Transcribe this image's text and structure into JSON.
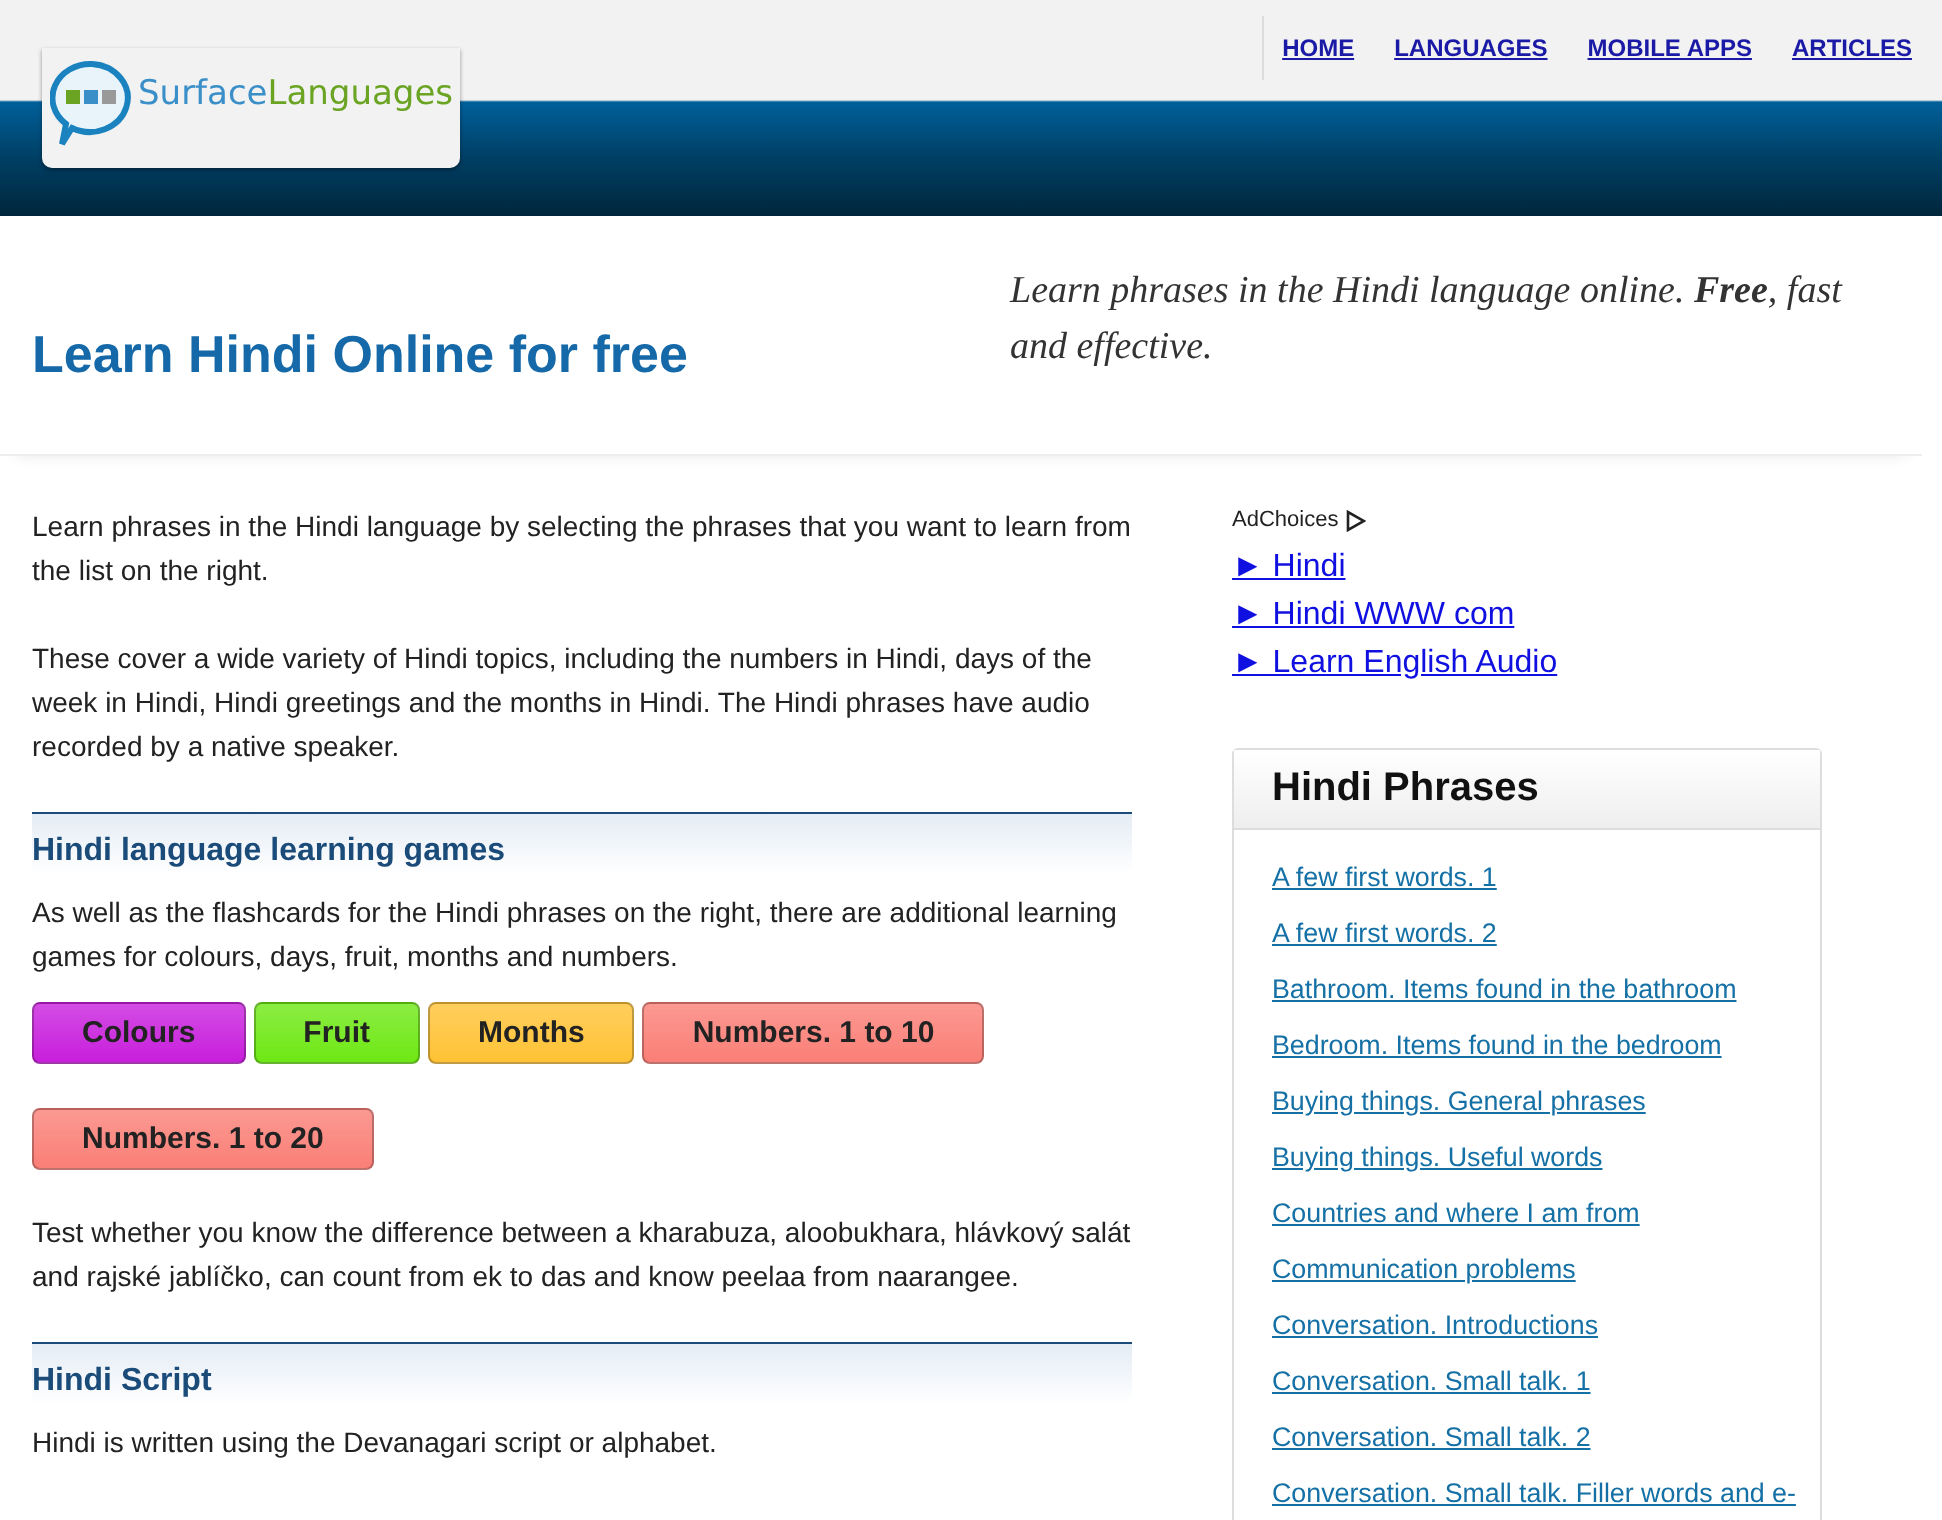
{
  "header": {
    "logo": {
      "part1": "Surface",
      "part2": "Languages"
    },
    "nav": [
      {
        "label": "HOME"
      },
      {
        "label": "LANGUAGES"
      },
      {
        "label": "MOBILE APPS"
      },
      {
        "label": "ARTICLES"
      }
    ]
  },
  "hero": {
    "title": "Learn Hindi Online for free",
    "tagline": "Learn phrases in the Hindi language online. **Free**, fast and effective."
  },
  "main": {
    "intro": [
      "Learn phrases in the Hindi language by selecting the phrases that you want to learn from the list on the right.",
      "These cover a wide variety of Hindi topics, including the numbers in Hindi, days of the week in Hindi, Hindi greetings and the months in Hindi. The Hindi phrases have audio recorded by a native speaker."
    ],
    "games": {
      "heading": "Hindi language learning games",
      "text": "As well as the flashcards for the Hindi phrases on the right, there are additional learning games for colours, days, fruit, months and numbers.",
      "buttons": [
        {
          "label": "Colours",
          "color": "#c81fdc"
        },
        {
          "label": "Fruit",
          "color": "#6ee814"
        },
        {
          "label": "Months",
          "color": "#ffc234"
        },
        {
          "label": "Numbers. 1 to 10",
          "color": "#fa7f77"
        },
        {
          "label": "Numbers. 1 to 20",
          "color": "#fa7f77"
        }
      ],
      "after": "Test whether you know the difference between a kharabuza, aloobukhara, hlávkový salát and rajské jablíčko, can count from ek to das and know peelaa from naarangee."
    },
    "script": {
      "heading": "Hindi Script",
      "text": "Hindi is written using the Devanagari script or alphabet."
    }
  },
  "sidebar": {
    "ad_label": "AdChoices",
    "ads": [
      {
        "label": "► Hindi"
      },
      {
        "label": "► Hindi WWW com"
      },
      {
        "label": "► Learn English Audio"
      }
    ],
    "phrases": {
      "title": "Hindi Phrases",
      "items": [
        "A few first words. 1",
        "A few first words. 2",
        "Bathroom. Items found in the bathroom",
        "Bedroom. Items found in the bedroom",
        "Buying things. General phrases",
        "Buying things. Useful words",
        "Countries and where I am from",
        "Communication problems",
        "Conversation. Introductions",
        "Conversation. Small talk. 1",
        "Conversation. Small talk. 2",
        "Conversation. Small talk. Filler words and e-"
      ]
    }
  }
}
